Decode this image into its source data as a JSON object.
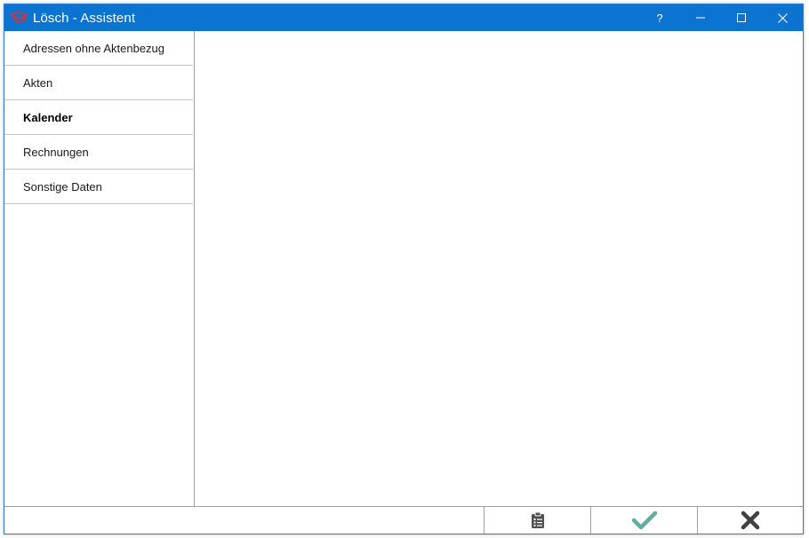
{
  "window": {
    "title": "Lösch - Assistent",
    "controls": {
      "help": "?",
      "minimize": "minimize-icon",
      "maximize": "maximize-icon",
      "close": "close-icon"
    },
    "titlebar_color": "#0a74d0"
  },
  "sidebar": {
    "items": [
      {
        "label": "Adressen ohne Aktenbezug",
        "active": false
      },
      {
        "label": "Akten",
        "active": false
      },
      {
        "label": "Kalender",
        "active": true
      },
      {
        "label": "Rechnungen",
        "active": false
      },
      {
        "label": "Sonstige Daten",
        "active": false
      }
    ]
  },
  "footer": {
    "buttons": [
      {
        "icon": "clipboard-list-icon",
        "color": "#505050"
      },
      {
        "icon": "checkmark-icon",
        "color": "#5fae9f"
      },
      {
        "icon": "cancel-x-icon",
        "color": "#404040"
      }
    ]
  }
}
